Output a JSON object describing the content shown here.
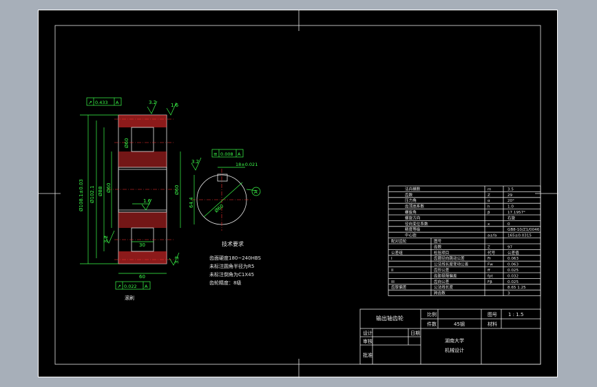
{
  "colors": {
    "sheet": "#000000",
    "outer_bg": "#a7afb9",
    "line": "#e8e8e8",
    "dimension": "#3cff4a",
    "hatch": "#ff3030",
    "centerline": "#ff3030",
    "arrow": "#3cff4a"
  },
  "callouts": {
    "runout_top": "0.433",
    "runout_top_datum": "A",
    "runout_bottom": "0.022",
    "runout_bottom_datum": "A",
    "roughness_1": "3.2",
    "roughness_2": "1.6",
    "roughness_3": "1.6",
    "roughness_4": "3.2",
    "roughness_5": "3.2",
    "roughness_6": "3.2",
    "roughness_7": "3.2",
    "symmetry": "0.008",
    "symmetry_datum": "A",
    "keyway_width": "18±0.021",
    "datum_label": "A"
  },
  "dims": {
    "tip_dia": "Ø108.1±0.03",
    "root_dia": "Ø102.1",
    "web_dia": "Ø88",
    "hub_dia": "Ø60",
    "bore": "Ø60",
    "hub_width": "30",
    "face_width": "60",
    "keyway_depth": "64.4",
    "section_bore_label": "Ø60",
    "web_thickness": "Ø60"
  },
  "section_label": "技术要求",
  "tech_requirements": [
    "齿面硬度180~240HBS",
    "未标注圆角半径为R5",
    "未标注倒角为C1X45",
    "齿轮精度：8级"
  ],
  "bottom_label": "滚刷",
  "gear_params": [
    {
      "name": "法向模数",
      "sym": "m",
      "val": "3.5"
    },
    {
      "name": "齿数",
      "sym": "Z",
      "val": "29"
    },
    {
      "name": "压力角",
      "sym": "α",
      "val": "20°"
    },
    {
      "name": "齿顶高系数",
      "sym": "h",
      "val": "1.0"
    },
    {
      "name": "螺旋角",
      "sym": "β",
      "val": "17.1957°"
    },
    {
      "name": "螺旋方向",
      "sym": "",
      "val": "右旋"
    },
    {
      "name": "径向变位系数",
      "sym": "x",
      "val": "0"
    },
    {
      "name": "精度等级",
      "sym": "",
      "val": "GB8-10/Z1/0046"
    },
    {
      "name": "中心距",
      "sym": "a±fa",
      "val": "165±0.0315"
    }
  ],
  "pair_params": [
    {
      "group": "配对齿轮",
      "name": "图号",
      "sym": "",
      "val": ""
    },
    {
      "group": "",
      "name": "齿数",
      "sym": "Z",
      "val": "97"
    },
    {
      "group": "公差组",
      "name": "检验项目",
      "sym": "代号",
      "val": "公差值"
    },
    {
      "group": "I",
      "name": "齿圈径向跳动公差",
      "sym": "Fr",
      "val": "0.063"
    },
    {
      "group": "",
      "name": "公法线长度变动公差",
      "sym": "Fw",
      "val": "0.063"
    },
    {
      "group": "II",
      "name": "齿形公差",
      "sym": "ff",
      "val": "0.025"
    },
    {
      "group": "",
      "name": "齿距极限偏差",
      "sym": "fpt",
      "val": "0.032"
    },
    {
      "group": "III",
      "name": "齿向公差",
      "sym": "Fβ",
      "val": "0.025"
    },
    {
      "group": "齿厚偏差",
      "name": "公法线长度",
      "sym": "",
      "val": "8.65 1.25"
    },
    {
      "group": "",
      "name": "跨齿数",
      "sym": "",
      "val": "3"
    }
  ],
  "title_block": {
    "part_name": "输出轴齿轮",
    "scale_label": "比例",
    "scale": "1 : 1.5",
    "qty_label": "件数",
    "material_label": "材料",
    "material": "45钢",
    "sheet_label": "图号",
    "drawn_label": "设计",
    "checked_label": "审核",
    "date_label": "日期",
    "approved_label": "批准",
    "school": "湖南大学",
    "class_label": "机械设计"
  }
}
